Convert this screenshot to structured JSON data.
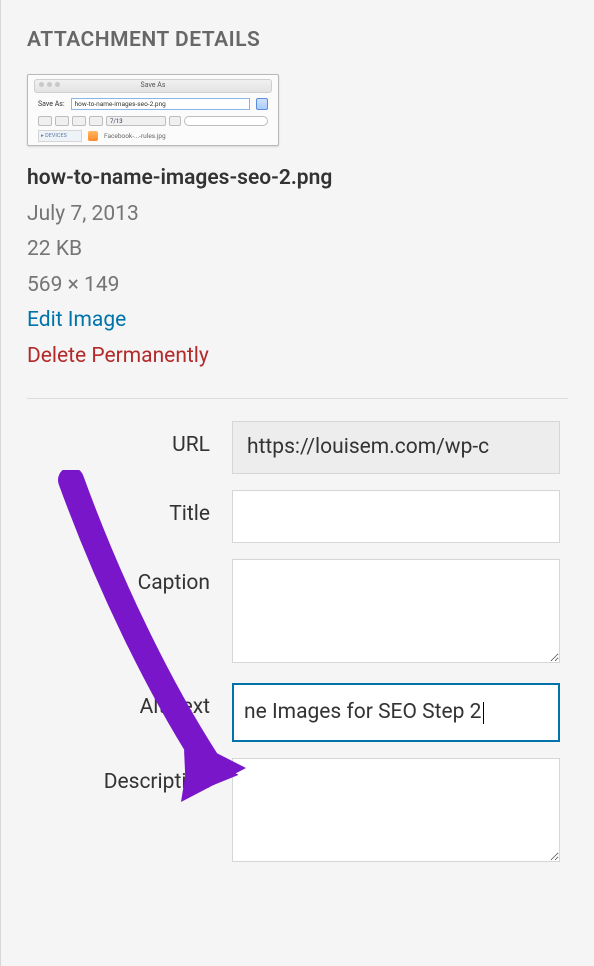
{
  "panel": {
    "title": "ATTACHMENT DETAILS"
  },
  "thumb": {
    "titlebar_label": "Save As",
    "saveas_label": "Save As:",
    "saveas_value": "how-to-name-images-seo-2.png",
    "folder_label": "7/13",
    "device_label": "▸ DEVICES",
    "filename": "Facebook-...-rules.jpg"
  },
  "meta": {
    "filename": "how-to-name-images-seo-2.png",
    "date": "July 7, 2013",
    "size": "22 KB",
    "dimensions": "569 × 149",
    "edit_label": "Edit Image",
    "delete_label": "Delete Permanently"
  },
  "fields": {
    "url": {
      "label": "URL",
      "value": "https://louisem.com/wp-c"
    },
    "title": {
      "label": "Title",
      "value": ""
    },
    "caption": {
      "label": "Caption",
      "value": ""
    },
    "alt": {
      "label": "Alt Text",
      "value": "ne Images for SEO Step 2"
    },
    "description": {
      "label": "Description",
      "value": ""
    }
  }
}
